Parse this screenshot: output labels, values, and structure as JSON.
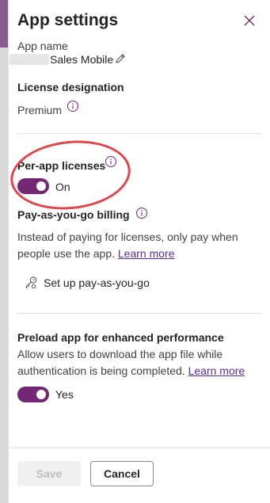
{
  "panel": {
    "title": "App settings",
    "close_icon": "close-icon"
  },
  "app_name": {
    "label": "App name",
    "value": "Sales Mobile",
    "edit_icon": "pencil-icon"
  },
  "license": {
    "heading": "License designation",
    "value": "Premium",
    "info_icon": "info-icon"
  },
  "per_app": {
    "heading": "Per-app licenses",
    "toggle_state": "On",
    "info_icon": "info-icon"
  },
  "payg": {
    "heading": "Pay-as-you-go billing",
    "description": "Instead of paying for licenses, only pay when people use the app.",
    "learn_more": "Learn more",
    "setup_label": "Set up pay-as-you-go",
    "setup_icon": "key-settings-icon"
  },
  "preload": {
    "heading": "Preload app for enhanced performance",
    "description": "Allow users to download the app file while authentication is being completed.",
    "learn_more": "Learn more",
    "toggle_state": "Yes"
  },
  "footer": {
    "save_label": "Save",
    "cancel_label": "Cancel"
  },
  "colors": {
    "accent": "#742774",
    "link": "#5c2e91",
    "annotation": "#e0474c"
  }
}
